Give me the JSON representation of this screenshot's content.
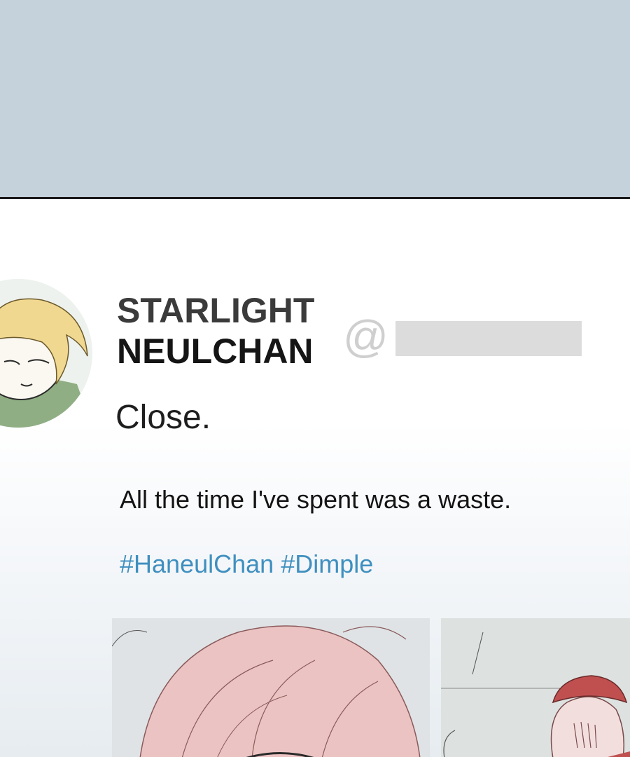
{
  "post": {
    "author": {
      "name_line1": "STARLIGHT",
      "name_line2": "NEULCHAN",
      "at_symbol": "@"
    },
    "status": "Close.",
    "body": "All the time I've spent was a waste.",
    "hashtags": [
      "#HaneulChan",
      "#Dimple"
    ],
    "colors": {
      "top_band": "#c5d2dc",
      "hashtag": "#3f8fbf",
      "redaction": "#dcdcdc"
    }
  }
}
